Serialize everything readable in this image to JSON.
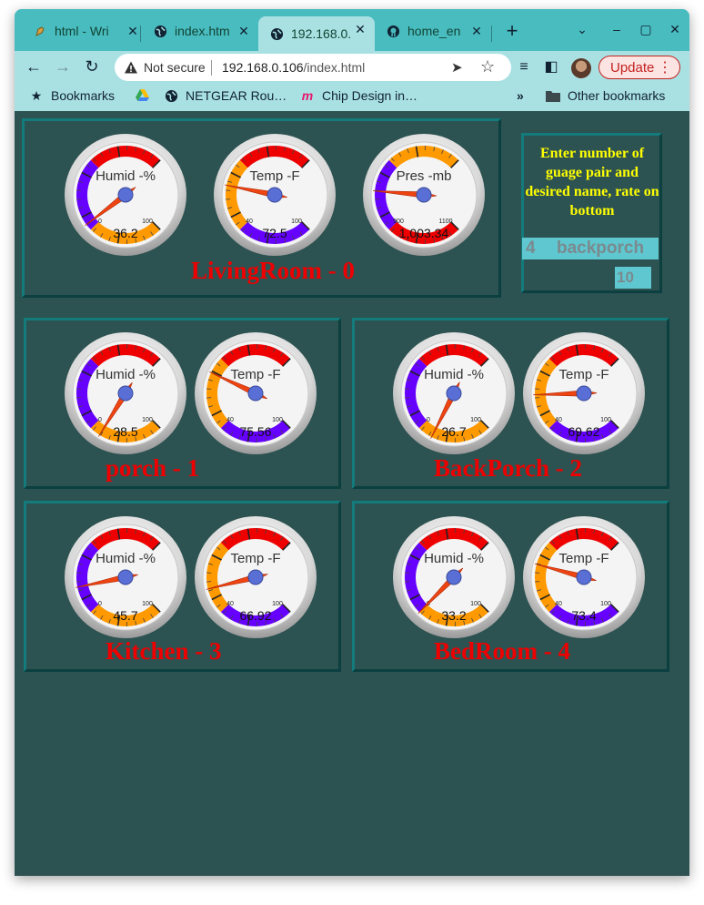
{
  "tabs": [
    {
      "title": "html - Wri",
      "icon": "pen-nib-icon"
    },
    {
      "title": "index.htm",
      "icon": "globe-icon"
    },
    {
      "title": "192.168.0.",
      "icon": "globe-icon",
      "active": true
    },
    {
      "title": "home_en",
      "icon": "github-icon"
    }
  ],
  "toolbar": {
    "security_label": "Not secure",
    "url_host": "192.168.0.106",
    "url_path": "/index.html",
    "update_label": "Update"
  },
  "bookmarks": {
    "bookmarks_label": "Bookmarks",
    "items": [
      "NETGEAR Rou…",
      "Chip Design in…"
    ],
    "other_label": "Other bookmarks"
  },
  "config": {
    "title": "Enter number of guage pair and desired name, rate on bottom",
    "number_value": "4",
    "name_value": "backporch",
    "rate_value": "10"
  },
  "colors": {
    "background": "#2c5251",
    "label": "#ee0000",
    "config_title": "#ffff00",
    "input_bg": "#5fc7cf",
    "gauge_violet": "#6600ff",
    "gauge_orange": "#ff9900",
    "gauge_red": "#ee0000"
  },
  "panels": [
    {
      "label": "LivingRoom - 0",
      "gauges": [
        {
          "title": "Humid -%",
          "min": "0",
          "max": "100",
          "value": 36.2,
          "display": "36.2",
          "scale": [
            0,
            100
          ],
          "zones": [
            "orange",
            "violet",
            "red"
          ]
        },
        {
          "title": "Temp -F",
          "min": "40",
          "max": "100",
          "value": 72.5,
          "display": "72.5",
          "scale": [
            40,
            100
          ],
          "zones": [
            "violet",
            "orange",
            "red"
          ]
        },
        {
          "title": "Pres -mb",
          "min": "900",
          "max": "1100",
          "value": 1003.34,
          "display": "1,003.34",
          "scale": [
            900,
            1100
          ],
          "zones": [
            "red",
            "violet",
            "orange"
          ]
        }
      ]
    },
    {
      "label": "porch - 1",
      "gauges": [
        {
          "title": "Humid -%",
          "min": "0",
          "max": "100",
          "value": 28.5,
          "display": "28.5",
          "scale": [
            0,
            100
          ],
          "zones": [
            "orange",
            "violet",
            "red"
          ]
        },
        {
          "title": "Temp -F",
          "min": "40",
          "max": "100",
          "value": 75.56,
          "display": "75.56",
          "scale": [
            40,
            100
          ],
          "zones": [
            "violet",
            "orange",
            "red"
          ]
        }
      ]
    },
    {
      "label": "BackPorch - 2",
      "gauges": [
        {
          "title": "Humid -%",
          "min": "0",
          "max": "100",
          "value": 26.7,
          "display": "26.7",
          "scale": [
            0,
            100
          ],
          "zones": [
            "orange",
            "violet",
            "red"
          ]
        },
        {
          "title": "Temp -F",
          "min": "40",
          "max": "100",
          "value": 69.62,
          "display": "69.62",
          "scale": [
            40,
            100
          ],
          "zones": [
            "violet",
            "orange",
            "red"
          ]
        }
      ]
    },
    {
      "label": "Kitchen - 3",
      "gauges": [
        {
          "title": "Humid -%",
          "min": "0",
          "max": "100",
          "value": 45.7,
          "display": "45.7",
          "scale": [
            0,
            100
          ],
          "zones": [
            "orange",
            "violet",
            "red"
          ]
        },
        {
          "title": "Temp -F",
          "min": "40",
          "max": "100",
          "value": 66.92,
          "display": "66.92",
          "scale": [
            40,
            100
          ],
          "zones": [
            "violet",
            "orange",
            "red"
          ]
        }
      ]
    },
    {
      "label": "BedRoom - 4",
      "gauges": [
        {
          "title": "Humid -%",
          "min": "0",
          "max": "100",
          "value": 33.2,
          "display": "33.2",
          "scale": [
            0,
            100
          ],
          "zones": [
            "orange",
            "violet",
            "red"
          ]
        },
        {
          "title": "Temp -F",
          "min": "40",
          "max": "100",
          "value": 73.4,
          "display": "73.4",
          "scale": [
            40,
            100
          ],
          "zones": [
            "violet",
            "orange",
            "red"
          ]
        }
      ]
    }
  ]
}
